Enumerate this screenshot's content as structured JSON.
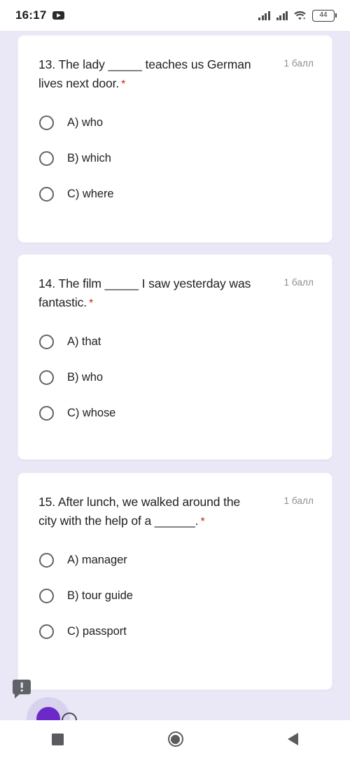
{
  "statusbar": {
    "time": "16:17",
    "media_icon": "youtube-icon",
    "signal_1_icon": "signal-bars-icon",
    "signal_2_icon": "signal-bars-icon",
    "wifi_icon": "wifi-icon",
    "battery_level": "44"
  },
  "form": {
    "points_label": "1 балл",
    "required_marker": "*",
    "questions": [
      {
        "text": "13. The lady _____ teaches us German lives next door.",
        "points": "1 балл",
        "required": "*",
        "options": [
          {
            "label": "A) who"
          },
          {
            "label": "B) which"
          },
          {
            "label": "C) where"
          }
        ]
      },
      {
        "text": "14. The film _____ I saw yesterday was fantastic.",
        "points": "1 балл",
        "required": "*",
        "options": [
          {
            "label": "A) that"
          },
          {
            "label": "B) who"
          },
          {
            "label": "C) whose"
          }
        ]
      },
      {
        "text": "15. After lunch, we walked around the city with the help of a ______.",
        "points": "1 балл",
        "required": "*",
        "options": [
          {
            "label": "A) manager"
          },
          {
            "label": "B) tour guide"
          },
          {
            "label": "C) passport"
          }
        ]
      }
    ]
  },
  "overlays": {
    "report_icon": "report-bubble-icon",
    "fab_icon": "floating-action-button"
  },
  "navbar": {
    "recents_icon": "recents-square-icon",
    "home_icon": "home-circle-icon",
    "back_icon": "back-triangle-icon"
  },
  "colors": {
    "page_background": "#eae7f6",
    "card_background": "#ffffff",
    "text_primary": "#202124",
    "text_muted": "#8d8d93",
    "required_red": "#c5221f",
    "fab_purple": "#6d28c9"
  }
}
